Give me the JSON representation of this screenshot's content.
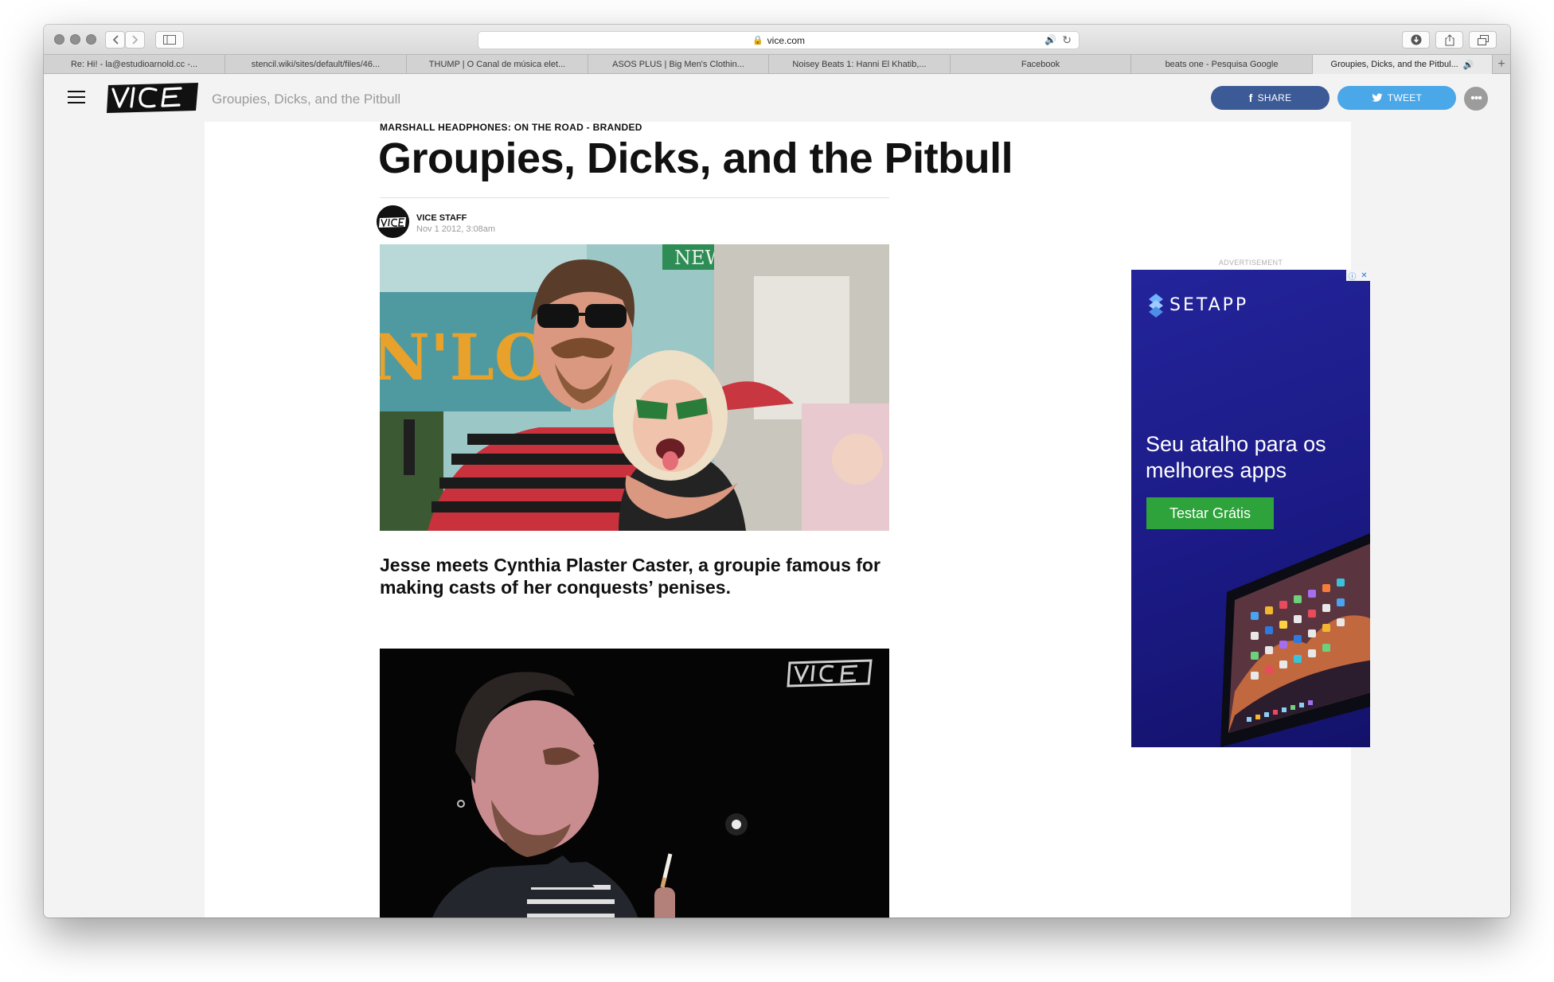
{
  "browser": {
    "address": "vice.com",
    "tabs": [
      "Re: Hi! - la@estudioarnold.cc -...",
      "stencil.wiki/sites/default/files/46...",
      "THUMP | O Canal de música elet...",
      "ASOS PLUS | Big Men's Clothin...",
      "Noisey Beats 1: Hanni El Khatib,...",
      "Facebook",
      "beats one - Pesquisa Google",
      "Groupies, Dicks, and the Pitbul..."
    ]
  },
  "header": {
    "page_title": "Groupies, Dicks, and the Pitbull",
    "share_label": "SHARE",
    "tweet_label": "TWEET",
    "more_label": "•••"
  },
  "article": {
    "kicker": "MARSHALL HEADPHONES: ON THE ROAD - BRANDED",
    "headline": "Groupies, Dicks, and the Pitbull",
    "author": "VICE STAFF",
    "date": "Nov 1 2012, 3:08am",
    "dek": "Jesse meets Cynthia Plaster Caster, a groupie famous for making casts of her conquests’ penises."
  },
  "ad": {
    "label": "ADVERTISEMENT",
    "brand": "SETAPP",
    "headline": "Seu atalho para os melhores apps",
    "cta": "Testar Grátis"
  },
  "colors": {
    "facebook": "#3b5a96",
    "twitter": "#4aa7e8",
    "ad_background": "#1b1a85",
    "ad_cta": "#2fa33b"
  }
}
